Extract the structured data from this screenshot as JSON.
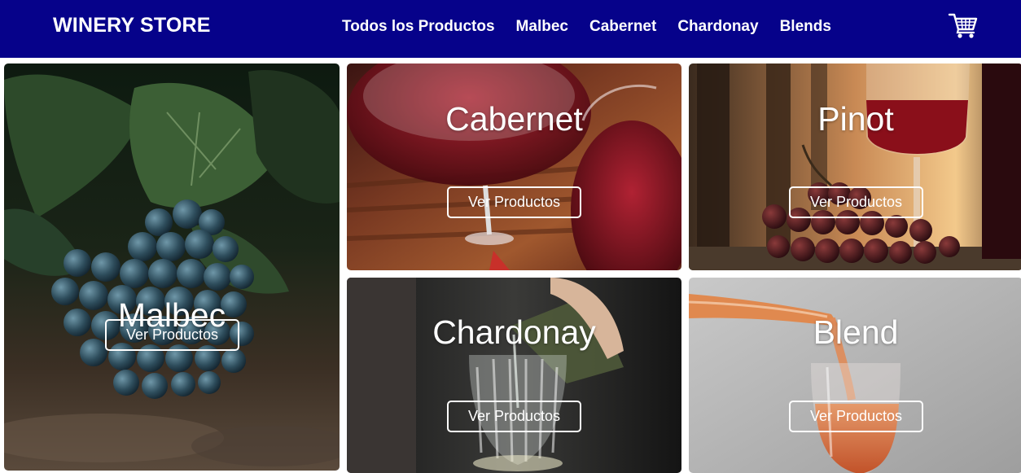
{
  "header": {
    "brand": "WINERY STORE",
    "nav": [
      {
        "label": "Todos los Productos"
      },
      {
        "label": "Malbec"
      },
      {
        "label": "Cabernet"
      },
      {
        "label": "Chardonay"
      },
      {
        "label": "Blends"
      }
    ],
    "cart_icon": "cart-icon"
  },
  "colors": {
    "navbar_bg": "#06028a",
    "text": "#ffffff"
  },
  "cards": [
    {
      "title": "Malbec",
      "button": "Ver Productos",
      "image": "green vine leaves with dark blue grape cluster"
    },
    {
      "title": "Cabernet",
      "button": "Ver Productos",
      "image": "glasses of red wine on wooden table"
    },
    {
      "title": "Pinot",
      "button": "Ver Productos",
      "image": "red wine glass with grapes at sunset"
    },
    {
      "title": "Chardonay",
      "button": "Ver Productos",
      "image": "white wine being poured into glass"
    },
    {
      "title": "Blend",
      "button": "Ver Productos",
      "image": "rosé wine poured into glass"
    }
  ]
}
